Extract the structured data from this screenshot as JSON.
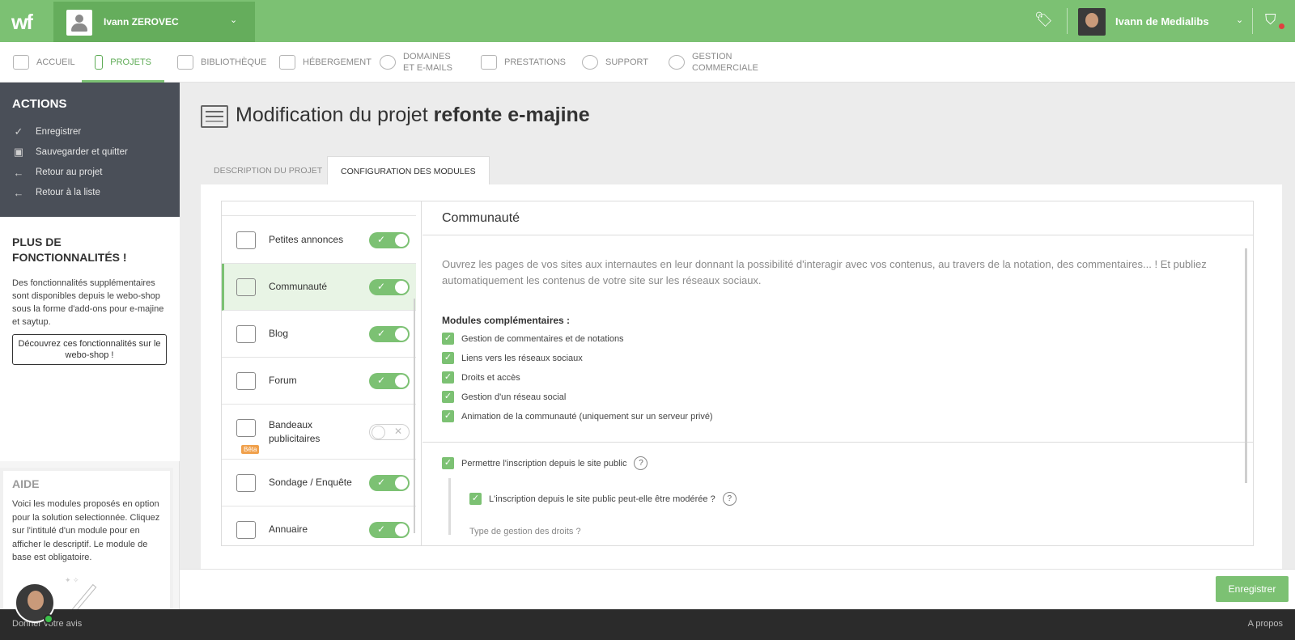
{
  "topbar": {
    "logo": "wf",
    "account_name": "Ivann ZEROVEC",
    "user_name": "Ivann de Medialibs",
    "colors": {
      "brand": "#7cc173",
      "brand_dark": "#65ad5c"
    }
  },
  "nav": {
    "items": [
      {
        "label": "ACCUEIL"
      },
      {
        "label": "PROJETS"
      },
      {
        "label": "BIBLIOTHÈQUE"
      },
      {
        "label": "HÉBERGEMENT"
      },
      {
        "label": "DOMAINES",
        "label2": "ET E-MAILS"
      },
      {
        "label": "PRESTATIONS"
      },
      {
        "label": "SUPPORT"
      },
      {
        "label": "GESTION",
        "label2": "COMMERCIALE"
      }
    ],
    "active": "PROJETS"
  },
  "sidebar": {
    "actions_title": "ACTIONS",
    "actions": [
      {
        "label": "Enregistrer",
        "icon": "check-icon"
      },
      {
        "label": "Sauvegarder et quitter",
        "icon": "save-icon"
      },
      {
        "label": "Retour au projet",
        "icon": "arrow-left-icon"
      },
      {
        "label": "Retour à la liste",
        "icon": "arrow-left-icon"
      }
    ],
    "plus_title": "PLUS DE FONCTIONNALITÉS !",
    "plus_text": "Des fonctionnalités supplémentaires sont disponibles depuis le webo-shop sous la forme d'add-ons pour e-majine et saytup.",
    "plus_button": "Découvrez ces fonctionnalités sur le webo-shop !",
    "aide_title": "AIDE",
    "aide_text": "Voici les modules proposés en option pour la solution selectionnée. Cliquez sur l'intitulé d'un module pour en afficher le descriptif. Le module de base est obligatoire."
  },
  "main": {
    "title_prefix": "Modification du projet",
    "title_bold": "refonte e-majine",
    "tabs": [
      {
        "label": "DESCRIPTION DU PROJET"
      },
      {
        "label": "CONFIGURATION DES MODULES"
      }
    ],
    "modules": [
      {
        "name": "Petites annonces",
        "enabled": true,
        "icon": "classifieds-icon"
      },
      {
        "name": "Communauté",
        "enabled": true,
        "icon": "community-icon"
      },
      {
        "name": "Blog",
        "enabled": true,
        "icon": "blog-icon"
      },
      {
        "name": "Forum",
        "enabled": true,
        "icon": "forum-icon"
      },
      {
        "name": "Bandeaux publicitaires",
        "enabled": false,
        "icon": "banner-icon",
        "badge": "Bêta"
      },
      {
        "name": "Sondage / Enquête",
        "enabled": true,
        "icon": "survey-icon"
      },
      {
        "name": "Annuaire",
        "enabled": true,
        "icon": "directory-icon"
      }
    ],
    "detail": {
      "title": "Communauté",
      "description": "Ouvrez les pages de vos sites aux internautes en leur donnant la possibilité d'interagir avec vos contenus, au travers de la notation, des commentaires... ! Et publiez automatiquement les contenus de votre site sur les réseaux sociaux.",
      "complementary_title": "Modules complémentaires :",
      "complementary": [
        "Gestion de commentaires et de notations",
        "Liens vers les réseaux sociaux",
        "Droits et accès",
        "Gestion d'un réseau social",
        "Animation de la communauté (uniquement sur un serveur privé)"
      ],
      "option_signup": "Permettre l'inscription depuis le site public",
      "option_moderate": "L'inscription depuis le site public peut-elle être modérée ?",
      "option_cut": "Type de gestion des droits ?"
    },
    "save_button": "Enregistrer"
  },
  "footer": {
    "left": "Donner votre avis",
    "right": "A propos"
  }
}
